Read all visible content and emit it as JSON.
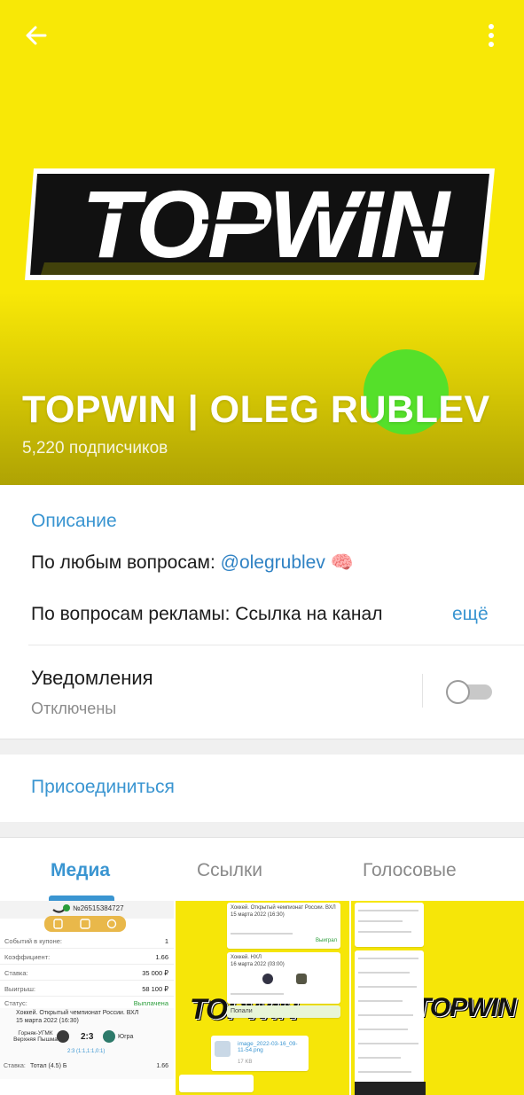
{
  "header": {
    "back_icon": "arrow-left-icon",
    "menu_icon": "more-vertical-icon",
    "logo_text": "TOPWIN",
    "title": "TOPWIN | OLEG RUBLEV",
    "subscribers": "5,220 подписчиков",
    "colors": {
      "cover": "#f8e806",
      "accent": "#3a95d1"
    }
  },
  "info": {
    "description_label": "Описание",
    "line1_text": "По любым вопросам: ",
    "line1_link": "@olegrublev",
    "line1_emoji": "🧠",
    "line2_text": "По вопросам рекламы: Ссылка на канал",
    "more": "ещё",
    "notifications_label": "Уведомления",
    "notifications_status": "Отключены",
    "notifications_enabled": false
  },
  "join": {
    "label": "Присоединиться"
  },
  "tabs": [
    {
      "label": "Медиа",
      "active": true
    },
    {
      "label": "Ссылки",
      "active": false
    },
    {
      "label": "Голосовые",
      "active": false
    }
  ],
  "media": {
    "receipt": {
      "number": "№26515384727",
      "rows": [
        {
          "label": "Событий в купоне:",
          "value": "1"
        },
        {
          "label": "Коэффициент:",
          "value": "1.66"
        },
        {
          "label": "Ставка:",
          "value": "35 000 ₽"
        },
        {
          "label": "Выигрыш:",
          "value": "58 100 ₽"
        },
        {
          "label": "Статус:",
          "value": "Выплачена"
        }
      ],
      "event_league": "Хоккей. Открытый чемпионат России. ВХЛ",
      "event_date": "15 марта 2022 (16:30)",
      "home": "Горняк-УГМК Верхняя Пышма",
      "away": "Югра",
      "score": "2:3",
      "periods": "2:3 (1:1,1:1,0:1)",
      "bet_label": "Ставка:",
      "bet_value": "Тотал (4.5) Б",
      "bet_odds": "1.66"
    },
    "chat": {
      "msg1": "Хоккей. Открытый чемпионат России. ВХЛ",
      "msg1_date": "15 марта 2022 (16:30)",
      "msg2": "Хоккей. НХЛ",
      "msg2_date": "16 марта 2022 (03:00)",
      "file_name": "image_2022-03-16_09-11-54.png",
      "file_size": "17 KB",
      "status_win": "Выиграл",
      "hit": "Попали",
      "today": "Сегодня"
    },
    "mini_logo": "TOPWIN"
  }
}
